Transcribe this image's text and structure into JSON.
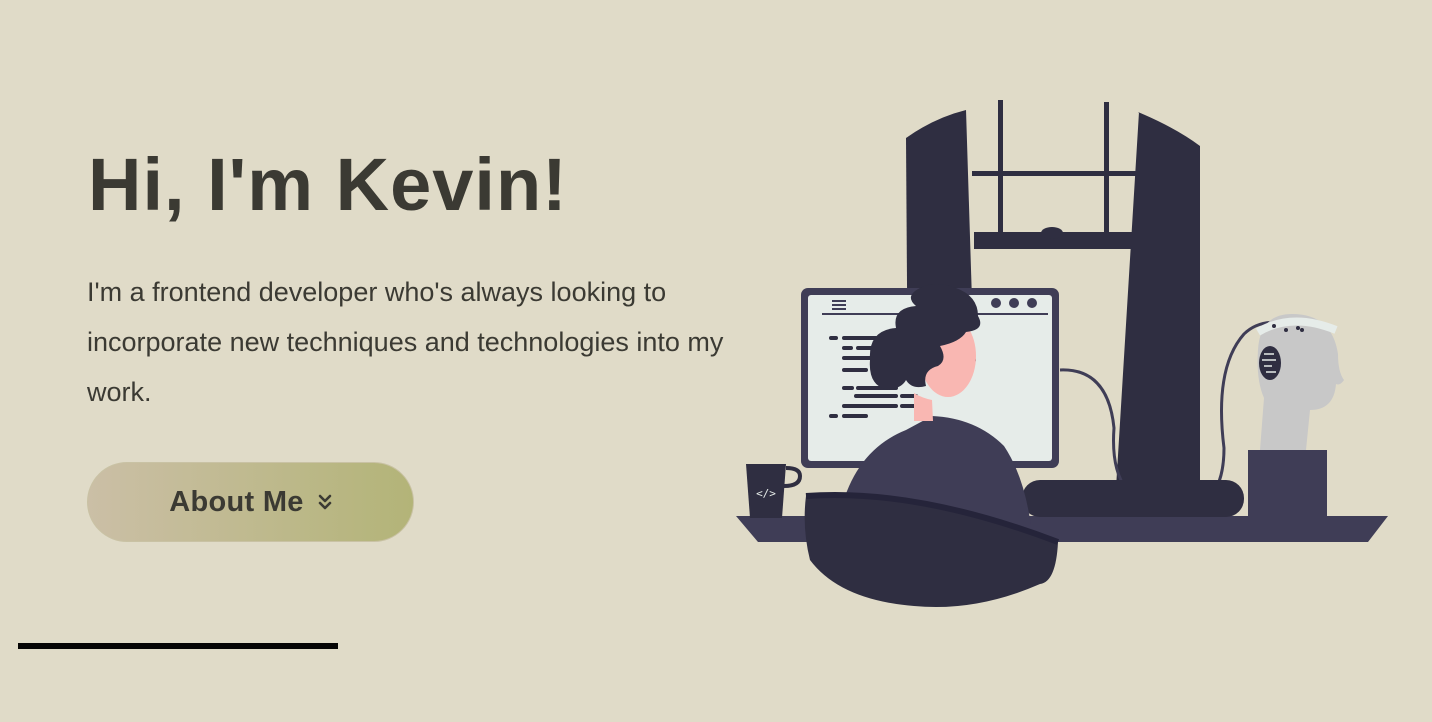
{
  "hero": {
    "title": "Hi, I'm Kevin!",
    "description": "I'm a frontend developer who's always looking to incorporate new techniques and technologies into my work.",
    "button_label": "About Me",
    "button_icon": "chevron-double-down-icon"
  },
  "illustration": {
    "name": "developer-at-desk-illustration",
    "mug_text": "</>"
  },
  "colors": {
    "background": "#e0dbc8",
    "text": "#3b3a33",
    "button_gradient_start": "#cbbfa6",
    "button_gradient_end": "#b3b478",
    "illustration_dark": "#2f2e41",
    "illustration_mid": "#3f3d56",
    "divider": "#050505"
  }
}
